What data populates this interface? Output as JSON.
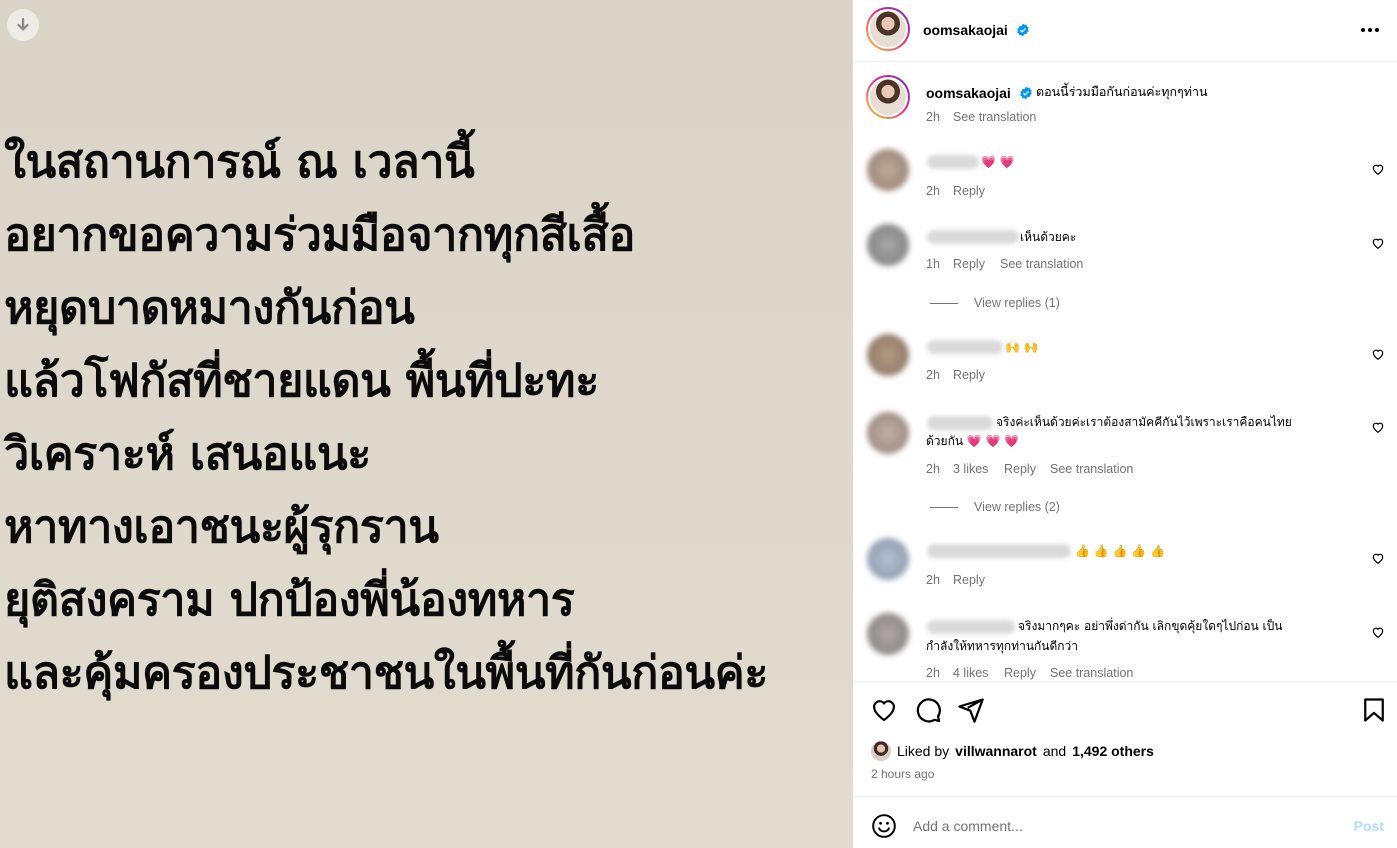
{
  "post": {
    "image_lines": [
      "ในสถานการณ์ ณ เวลานี้",
      "อยากขอความร่วมมือจากทุกสีเสื้อ",
      "หยุดบาดหมางกันก่อน",
      "แล้วโฟกัสที่ชายแดน พื้นที่ปะทะ",
      "วิเคราะห์ เสนอแนะ",
      "หาทางเอาชนะผู้รุกราน",
      "ยุติสงคราม ปกป้องพี่น้องทหาร",
      "และคุ้มครองประชาชนในพื้นที่กันก่อนค่ะ"
    ],
    "download_icon": "download-arrow-icon"
  },
  "header": {
    "username": "oomsakaojai",
    "verified_icon": "verified-badge-icon",
    "more_icon": "more-options-icon"
  },
  "caption": {
    "username": "oomsakaojai",
    "text": "ตอนนี้ร่วมมือกันก่อนค่ะทุกๆท่าน",
    "time": "2h",
    "see_translation": "See translation"
  },
  "comments": [
    {
      "text": "💗 💗",
      "time": "2h",
      "reply": "Reply",
      "avatar_color": "#9b7f6b"
    },
    {
      "text": "เห็นด้วยคะ",
      "time": "1h",
      "reply": "Reply",
      "see_translation": "See translation",
      "view_replies": "View replies (1)",
      "avatar_color": "#7f7f7f"
    },
    {
      "text": "🙌 🙌",
      "time": "2h",
      "reply": "Reply",
      "avatar_color": "#8a7055"
    },
    {
      "text_line1": "จริงค่ะเห็นด้วยค่ะเราต้องสามัคคีกันไว้เพราะเราคือคนไทย",
      "text_line2": "ด้วยกัน 💗 💗 💗",
      "time": "2h",
      "likes": "3 likes",
      "reply": "Reply",
      "see_translation": "See translation",
      "view_replies": "View replies (2)",
      "avatar_color": "#a58e80"
    },
    {
      "text": "👍 👍 👍 👍 👍",
      "time": "2h",
      "reply": "Reply",
      "avatar_color": "#8fa0b5"
    },
    {
      "text_line1": "จริงมากๆคะ อย่าพึ่งด่ากัน เลิกขุดคุ้ยใดๆไปก่อน เป็น",
      "text_line2": "กำลังให้ทหารทุกท่านกันดีกว่า",
      "time": "2h",
      "likes": "4 likes",
      "reply": "Reply",
      "see_translation": "See translation",
      "avatar_color": "#8a8584"
    }
  ],
  "actions": {
    "liked_prefix": "Liked by",
    "liked_user": "villwannarot",
    "liked_and": "and",
    "liked_others": "1,492 others",
    "time_ago": "2 hours ago"
  },
  "comment_box": {
    "placeholder": "Add a comment...",
    "post_label": "Post"
  }
}
